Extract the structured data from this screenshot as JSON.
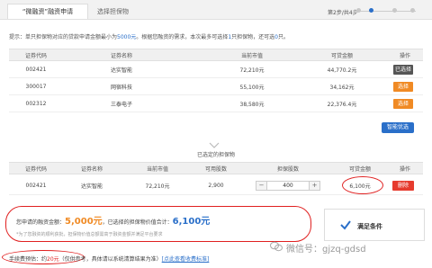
{
  "header": {
    "active_tab": "“微融资”融资申请",
    "next_tab": "选择担保物",
    "step": "第2步/共4步"
  },
  "tip": {
    "prefix": "提示：单只担保物对应的贷款申请金额最小为",
    "min_amount": "5000元",
    "middle": "。根据您融资的需求，本次最多可选择",
    "max_count": "1",
    "middle2": "只担保物，还可选",
    "remain": "0",
    "suffix": "只。"
  },
  "top_table": {
    "headers": [
      "证券代码",
      "证券名称",
      "当前市值",
      "可贷金额",
      "操作"
    ],
    "rows": [
      {
        "code": "002421",
        "name": "达实智能",
        "value": "72,210元",
        "loan": "44,770.2元",
        "action": "已选择"
      },
      {
        "code": "300017",
        "name": "网宿科技",
        "value": "55,100元",
        "loan": "34,162元",
        "action": "选择"
      },
      {
        "code": "002312",
        "name": "三泰电子",
        "value": "38,580元",
        "loan": "22,376.4元",
        "action": "选择"
      }
    ],
    "smart_button": "智能优选"
  },
  "selected_section": {
    "title": "已选定的担保物",
    "headers": [
      "证券代码",
      "证券名称",
      "当前市值",
      "可用股数",
      "担保股数",
      "可贷金额",
      "操作"
    ],
    "row": {
      "code": "002421",
      "name": "达实智能",
      "value": "72,210元",
      "available": "2,900",
      "pledged": "400",
      "loan": "6,100元",
      "action": "删除"
    },
    "minus": "−",
    "plus": "+"
  },
  "summary": {
    "label1": "您申请的融资金额：",
    "amount": "5,000元",
    "label2": "，已选择的担保物价值合计：",
    "pledge_total": "6,100元",
    "note": "*为了您融资的顺利获批，担保物价值总额需高于融资金额并满足平台要求"
  },
  "satisfy": {
    "label": "满足条件"
  },
  "fee": {
    "label": "手续费预估：约",
    "amount": "20元",
    "note": "（仅供参考，具体请以系统清算结果为准）",
    "link": "[点此查看收费标准]"
  },
  "watermark": "微信号：gjzq-gdsd",
  "colors": {
    "accent_blue": "#2a6fc9",
    "accent_orange": "#f08a24",
    "danger_red": "#e63b2e"
  }
}
